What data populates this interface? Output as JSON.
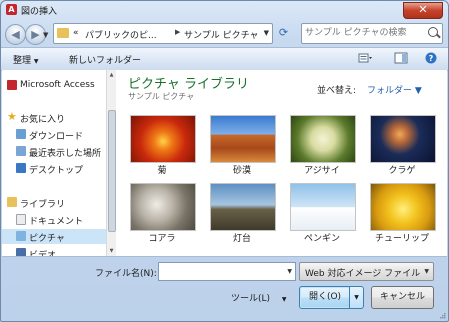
{
  "window": {
    "title": "図の挿入",
    "close_glyph": "✕"
  },
  "nav": {
    "back_glyph": "◀",
    "forward_glyph": "▶",
    "address": {
      "prefix": "«",
      "crumbs": [
        "パブリックのピ...",
        "サンプル ピクチャ"
      ],
      "separator": "▶"
    },
    "refresh_glyph": "⟳",
    "search": {
      "placeholder": "サンプル ピクチャの検索"
    }
  },
  "toolbar": {
    "organize_label": "整理",
    "new_folder_label": "新しいフォルダー"
  },
  "navpane": {
    "items": [
      {
        "label": "Microsoft Access",
        "icon": "access-icon",
        "color": "#c2272d"
      },
      {
        "label": "お気に入り",
        "icon": "star-icon",
        "color": "#f4c430"
      },
      {
        "label": "ダウンロード",
        "icon": "download-folder-icon",
        "color": "#6a9fd4"
      },
      {
        "label": "最近表示した場所",
        "icon": "recent-places-icon",
        "color": "#7aa6d6"
      },
      {
        "label": "デスクトップ",
        "icon": "desktop-icon",
        "color": "#3a78c4"
      },
      {
        "label": "ライブラリ",
        "icon": "library-icon",
        "color": "#e8c05c"
      },
      {
        "label": "ドキュメント",
        "icon": "documents-icon",
        "color": "#d9d9d9"
      },
      {
        "label": "ピクチャ",
        "icon": "pictures-icon",
        "color": "#7fb3e0"
      },
      {
        "label": "ビデオ",
        "icon": "videos-icon",
        "color": "#4a6ea8"
      }
    ]
  },
  "content": {
    "library_title": "ピクチャ ライブラリ",
    "library_subtitle": "サンプル ピクチャ",
    "sort_label": "並べ替え:",
    "sort_value": "フォルダー ▼",
    "thumbnails": [
      {
        "caption": "菊",
        "icon": "chrysanthemum-image"
      },
      {
        "caption": "砂漠",
        "icon": "desert-image"
      },
      {
        "caption": "アジサイ",
        "icon": "hydrangeas-image"
      },
      {
        "caption": "クラゲ",
        "icon": "jellyfish-image"
      },
      {
        "caption": "コアラ",
        "icon": "koala-image"
      },
      {
        "caption": "灯台",
        "icon": "lighthouse-image"
      },
      {
        "caption": "ペンギン",
        "icon": "penguins-image"
      },
      {
        "caption": "チューリップ",
        "icon": "tulips-image"
      }
    ]
  },
  "bottom": {
    "filename_label": "ファイル名(N):",
    "filename_value": "",
    "filetype_value": "Web 対応イメージ ファイル",
    "tools_label": "ツール(L)",
    "open_label": "開く(O)",
    "cancel_label": "キャンセル"
  }
}
